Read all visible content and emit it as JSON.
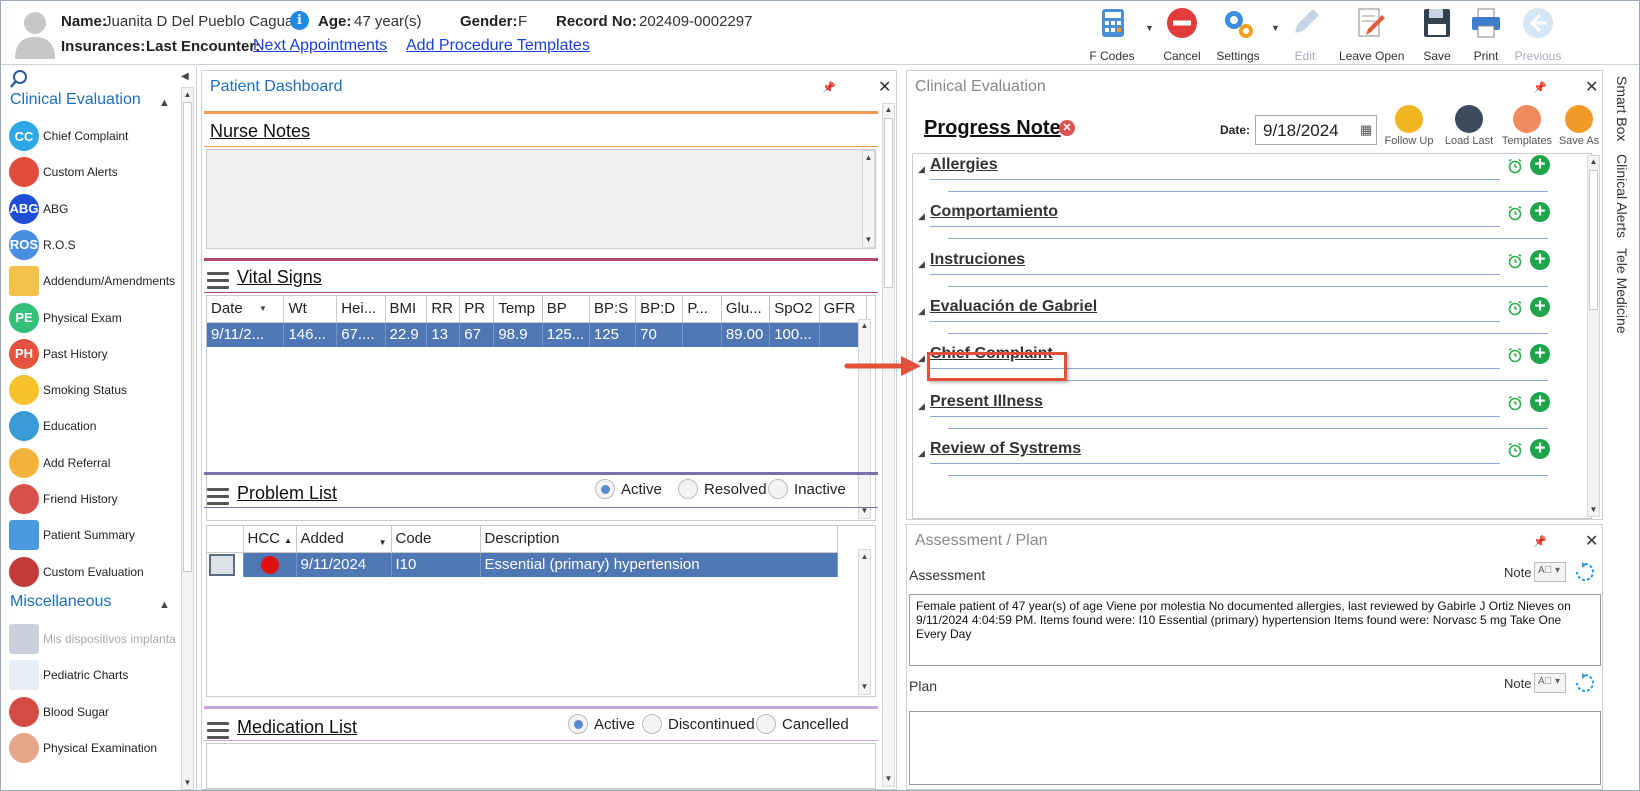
{
  "header": {
    "name_label": "Name:",
    "name_value": "Juanita D Del Pueblo Caguas",
    "age_label": "Age:",
    "age_value": "47 year(s)",
    "gender_label": "Gender:",
    "gender_value": "F",
    "record_label": "Record No:",
    "record_value": "202409-0002297",
    "insurances_label": "Insurances:",
    "last_encounter_label": "Last Encounter:",
    "next_appointments_link": "Next Appointments",
    "add_procedure_link": "Add Procedure Templates"
  },
  "toolbar": {
    "fcodes": "F Codes",
    "cancel": "Cancel",
    "settings": "Settings",
    "edit": "Edit",
    "leave_open": "Leave Open",
    "save": "Save",
    "print": "Print",
    "previous": "Previous"
  },
  "sidebar": {
    "section1": "Clinical Evaluation",
    "section2": "Miscellaneous",
    "items": [
      {
        "label": "Chief Complaint",
        "abbr": "CC"
      },
      {
        "label": "Custom Alerts",
        "abbr": ""
      },
      {
        "label": "ABG",
        "abbr": "ABG"
      },
      {
        "label": "R.O.S",
        "abbr": "ROS"
      },
      {
        "label": "Addendum/Amendments",
        "abbr": ""
      },
      {
        "label": "Physical Exam",
        "abbr": "PE"
      },
      {
        "label": "Past History",
        "abbr": "PH"
      },
      {
        "label": "Smoking Status",
        "abbr": ""
      },
      {
        "label": "Education",
        "abbr": ""
      },
      {
        "label": "Add Referral",
        "abbr": ""
      },
      {
        "label": "Friend History",
        "abbr": ""
      },
      {
        "label": "Patient Summary",
        "abbr": ""
      },
      {
        "label": "Custom Evaluation",
        "abbr": ""
      }
    ],
    "misc_items": [
      {
        "label": "Mis dispositivos implanta"
      },
      {
        "label": "Pediatric Charts"
      },
      {
        "label": "Blood Sugar"
      },
      {
        "label": "Physical Examination"
      }
    ]
  },
  "dashboard": {
    "title": "Patient Dashboard",
    "nurse_notes": "Nurse Notes",
    "vital_signs": "Vital Signs",
    "vitals_columns": [
      "Date",
      "Wt",
      "Hei...",
      "BMI",
      "RR",
      "PR",
      "Temp",
      "BP",
      "BP:S",
      "BP:D",
      "P...",
      "Glu...",
      "SpO2",
      "GFR"
    ],
    "vitals_row": [
      "9/11/2...",
      "146...",
      "67....",
      "22.9",
      "13",
      "67",
      "98.9",
      "125...",
      "125",
      "70",
      "",
      "89.00",
      "100...",
      ""
    ],
    "problem_list": "Problem List",
    "problem_filters": [
      "Active",
      "Resolved",
      "Inactive"
    ],
    "problem_columns": [
      "HCC",
      "Added",
      "Code",
      "Description"
    ],
    "problem_row": {
      "added": "9/11/2024",
      "code": "I10",
      "description": "Essential (primary) hypertension"
    },
    "medication_list": "Medication List",
    "medication_filters": [
      "Active",
      "Discontinued",
      "Cancelled"
    ]
  },
  "clinical": {
    "title": "Clinical Evaluation",
    "note_title": "Progress Note",
    "date_label": "Date:",
    "date_value": "9/18/2024",
    "actions": [
      "Follow Up",
      "Load Last",
      "Templates",
      "Save As"
    ],
    "sections": [
      "Allergies",
      "Comportamiento",
      "Instruciones",
      "Evaluación de Gabriel",
      "Chief Complaint",
      "Present Illness",
      "Review of Systrems"
    ]
  },
  "assessment": {
    "title": "Assessment / Plan",
    "assessment_label": "Assessment",
    "note_label": "Note",
    "assessment_text": "Female patient of 47 year(s) of age Viene por molestia     No documented allergies, last reviewed by Gabirle J Ortiz Nieves on 9/11/2024 4:04:59 PM.     Items found were:  I10 Essential (primary) hypertension  Items found were:  Norvasc 5 mg Take One Every Day",
    "plan_label": "Plan",
    "plan_text": ""
  },
  "right_tabs": [
    "Smart Box",
    "Clinical Alerts",
    "Tele Medicine"
  ],
  "colors": {
    "accent": "#1d6fb8",
    "selection": "#4e77b3",
    "add": "#1ea44b",
    "highlight": "#e0503a"
  }
}
